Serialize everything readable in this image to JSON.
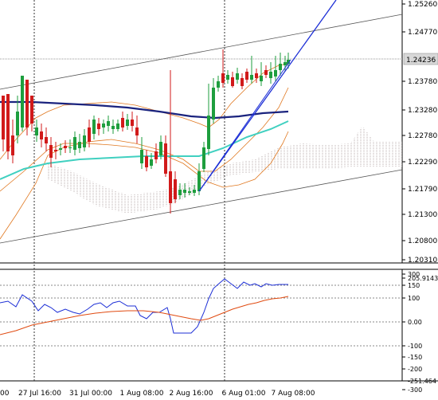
{
  "chart_data": {
    "type": "candlestick",
    "symbol_price": "1.24236",
    "price_ticks": [
      "1.25260",
      "1.24770",
      "1.24236",
      "1.23780",
      "1.23280",
      "1.22780",
      "1.22290",
      "1.21790",
      "1.21300",
      "1.20800",
      "1.20310"
    ],
    "ind_ticks": [
      "300",
      "205.9143",
      "150",
      "100",
      "0.00",
      "-100",
      "-150",
      "-200",
      "-251.464",
      "-300"
    ],
    "time_labels": [
      "00",
      "27 Jul 16:00",
      "31 Jul 00:00",
      "1 Aug 08:00",
      "2 Aug 16:00",
      "6 Aug 01:00",
      "7 Aug 08:00"
    ],
    "colors": {
      "bull": "#1e9e3e",
      "bear": "#d11a1a",
      "ma_slow": "#1a237e",
      "ma_fast": "#40d0c0",
      "envelope": "#e07820",
      "trend": "#1d2fd6",
      "cloud": "#9a8a8a",
      "cci": "#1d2fd6",
      "signal": "#e04a10"
    }
  }
}
